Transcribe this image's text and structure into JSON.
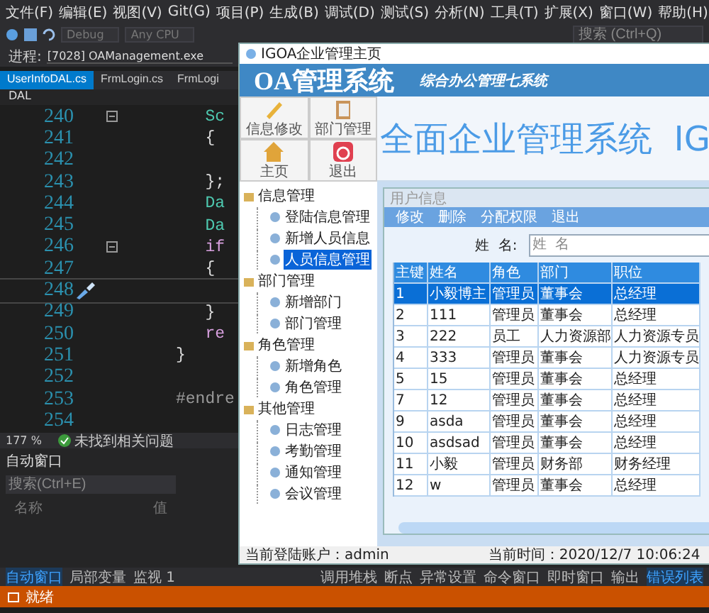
{
  "menu": [
    "文件(F)",
    "编辑(E)",
    "视图(V)",
    "Git(G)",
    "项目(P)",
    "生成(B)",
    "调试(D)",
    "测试(S)",
    "分析(N)",
    "工具(T)",
    "扩展(X)",
    "窗口(W)",
    "帮助(H)"
  ],
  "toolbar": {
    "config": "Debug",
    "platform": "Any CPU",
    "search": {
      "placeholder": "搜索 (Ctrl+Q)"
    }
  },
  "process": {
    "label": "进程:",
    "value": "[7028] OAManagement.exe"
  },
  "tabs": [
    {
      "label": "UserInfoDAL.cs",
      "selected": true
    },
    {
      "label": "FrmLogin.cs",
      "selected": false
    },
    {
      "label": "FrmLogi",
      "selected": false
    }
  ],
  "breadcrumb": "DAL",
  "code": [
    {
      "number": "240",
      "text": "   Sc",
      "kind": "type"
    },
    {
      "number": "241",
      "text": "   {",
      "kind": "plain"
    },
    {
      "number": "242"
    },
    {
      "number": "243",
      "text": "   };",
      "kind": "plain"
    },
    {
      "number": "244",
      "text": "   Da",
      "kind": "type"
    },
    {
      "number": "245",
      "text": "   Da",
      "kind": "type"
    },
    {
      "number": "246",
      "text": "   if",
      "kind": "keyword"
    },
    {
      "number": "247",
      "text": "   {",
      "kind": "plain"
    },
    {
      "number": "248"
    },
    {
      "number": "249",
      "text": "   }",
      "kind": "plain"
    },
    {
      "number": "250",
      "text": "   re",
      "kind": "keyword"
    },
    {
      "number": "251",
      "text": "}",
      "kind": "plain"
    },
    {
      "number": "252"
    },
    {
      "number": "253",
      "text": "#endre",
      "kind": "directive"
    },
    {
      "number": "254"
    }
  ],
  "editor_status": {
    "zoom": "177 %",
    "issues": "未找到相关问题"
  },
  "autos": {
    "title": "自动窗口",
    "search": {
      "placeholder": "搜索(Ctrl+E)"
    },
    "columns": [
      "名称",
      "值"
    ]
  },
  "bottom_tabs_left": [
    {
      "label": "自动窗口",
      "selected": true
    },
    {
      "label": "局部变量",
      "selected": false
    },
    {
      "label": "监视 1",
      "selected": false
    }
  ],
  "bottom_tabs_right": [
    {
      "label": "调用堆栈",
      "selected": false
    },
    {
      "label": "断点",
      "selected": false
    },
    {
      "label": "异常设置",
      "selected": false
    },
    {
      "label": "命令窗口",
      "selected": false
    },
    {
      "label": "即时窗口",
      "selected": false
    },
    {
      "label": "输出",
      "selected": false
    },
    {
      "label": "错误列表",
      "selected": true
    }
  ],
  "status_bar": "就绪",
  "app": {
    "title": "IGOA企业管理主页",
    "logo": "OA管理系统",
    "slogan": "综合办公管理七系统",
    "banner": "全面企业管理系统  IG",
    "buttons": [
      {
        "label": "信息修改",
        "kind": "edit"
      },
      {
        "label": "部门管理",
        "kind": "clipboard"
      },
      {
        "label": "主页",
        "kind": "home"
      },
      {
        "label": "退出",
        "kind": "power"
      }
    ],
    "tree": [
      {
        "label": "信息管理",
        "children": [
          {
            "label": "登陆信息管理",
            "selected": false
          },
          {
            "label": "新增人员信息",
            "selected": false
          },
          {
            "label": "人员信息管理",
            "selected": true
          }
        ]
      },
      {
        "label": "部门管理",
        "children": [
          {
            "label": "新增部门",
            "selected": false
          },
          {
            "label": "部门管理",
            "selected": false
          }
        ]
      },
      {
        "label": "角色管理",
        "children": [
          {
            "label": "新增角色",
            "selected": false
          },
          {
            "label": "角色管理",
            "selected": false
          }
        ]
      },
      {
        "label": "其他管理",
        "children": [
          {
            "label": "日志管理",
            "selected": false
          },
          {
            "label": "考勤管理",
            "selected": false
          },
          {
            "label": "通知管理",
            "selected": false
          },
          {
            "label": "会议管理",
            "selected": false
          }
        ]
      }
    ],
    "status": {
      "account": "当前登陆账户：admin",
      "time": "当前时间：2020/12/7 10:06:24"
    },
    "child": {
      "title": "用户信息",
      "actions": [
        "修改",
        "删除",
        "分配权限",
        "退出"
      ],
      "search_label": "姓  名:",
      "search": {
        "placeholder": "姓  名"
      },
      "columns": [
        "主键",
        "姓名",
        "角色",
        "部门",
        "职位"
      ],
      "rows": [
        {
          "cells": [
            "1",
            "小毅博主",
            "管理员",
            "董事会",
            "总经理"
          ],
          "selected": true
        },
        {
          "cells": [
            "2",
            "111",
            "管理员",
            "董事会",
            "总经理"
          ],
          "selected": false
        },
        {
          "cells": [
            "3",
            "222",
            "员工",
            "人力资源部",
            "人力资源专员"
          ],
          "selected": false
        },
        {
          "cells": [
            "4",
            "333",
            "管理员",
            "董事会",
            "人力资源专员"
          ],
          "selected": false
        },
        {
          "cells": [
            "5",
            "15",
            "管理员",
            "董事会",
            "总经理"
          ],
          "selected": false
        },
        {
          "cells": [
            "7",
            "12",
            "管理员",
            "董事会",
            "总经理"
          ],
          "selected": false
        },
        {
          "cells": [
            "9",
            "asda",
            "管理员",
            "董事会",
            "总经理"
          ],
          "selected": false
        },
        {
          "cells": [
            "10",
            "asdsad",
            "管理员",
            "董事会",
            "总经理"
          ],
          "selected": false
        },
        {
          "cells": [
            "11",
            "小毅",
            "管理员",
            "财务部",
            "财务经理"
          ],
          "selected": false
        },
        {
          "cells": [
            "12",
            "w",
            "管理员",
            "董事会",
            "总经理"
          ],
          "selected": false
        }
      ]
    }
  }
}
